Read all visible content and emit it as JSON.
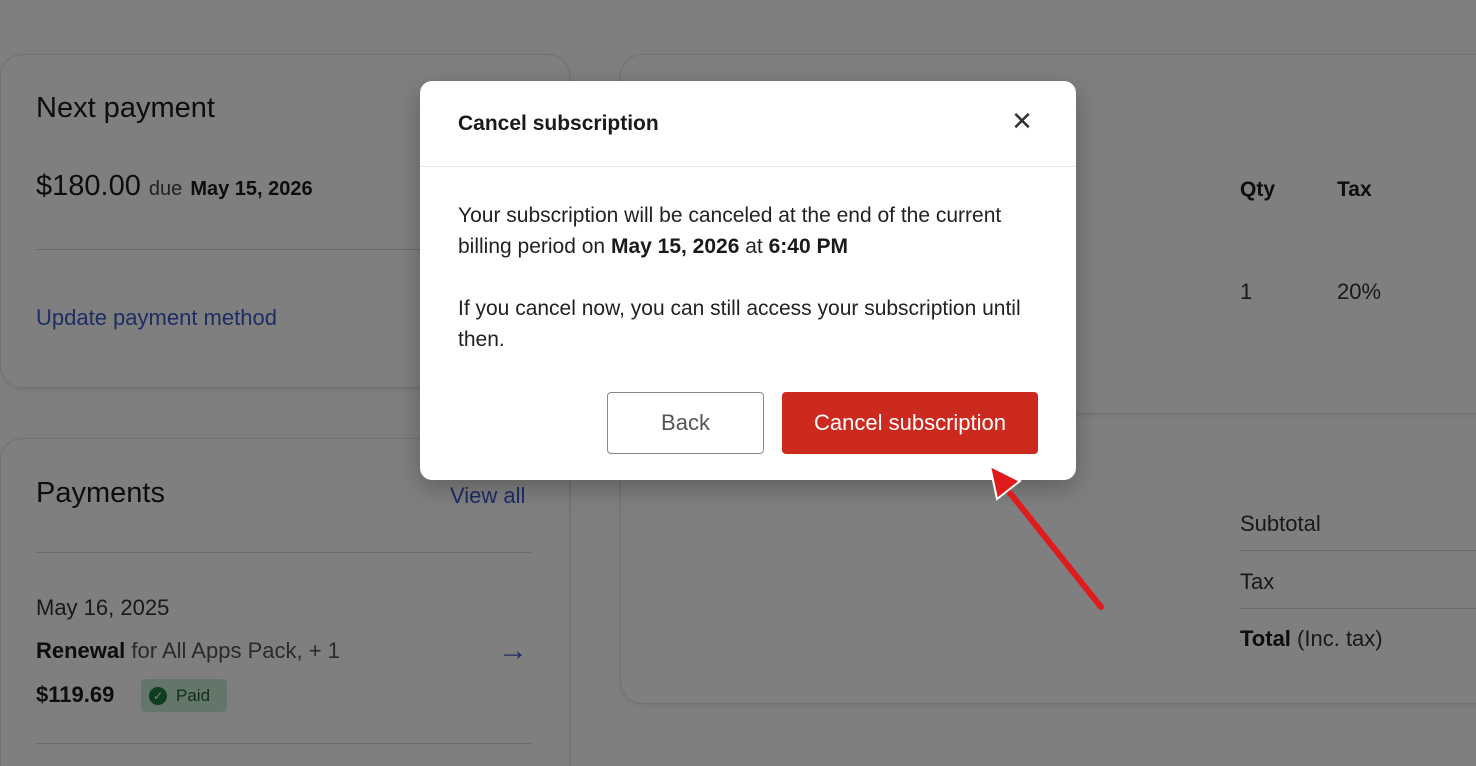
{
  "next_payment": {
    "title": "Next payment",
    "amount": "$180.00",
    "due_word": "due",
    "due_date": "May 15, 2026",
    "update_link": "Update payment method"
  },
  "payments": {
    "title": "Payments",
    "view_all": "View all",
    "item": {
      "date": "May 16, 2025",
      "type": "Renewal",
      "description": "for All Apps Pack, + 1",
      "amount": "$119.69",
      "status": "Paid"
    }
  },
  "order_table": {
    "headers": {
      "qty": "Qty",
      "tax": "Tax"
    },
    "row": {
      "qty": "1",
      "tax": "20%"
    }
  },
  "summary": {
    "subtotal": "Subtotal",
    "tax": "Tax",
    "total_bold": "Total",
    "total_suffix": "(Inc. tax)"
  },
  "modal": {
    "title": "Cancel subscription",
    "close_icon": "close-icon",
    "line1_prefix": "Your subscription will be canceled at the end of the current billing period on",
    "line1_date": "May 15, 2026",
    "line1_at": "at",
    "line1_time": "6:40 PM",
    "line2": "If you cancel now, you can still access your subscription until then.",
    "back_label": "Back",
    "confirm_label": "Cancel subscription"
  },
  "colors": {
    "accent_link": "#3b5bc6",
    "danger": "#cc2a1e",
    "paid_badge_bg": "#c6ecd2",
    "annotation_arrow": "#e01b1b"
  }
}
